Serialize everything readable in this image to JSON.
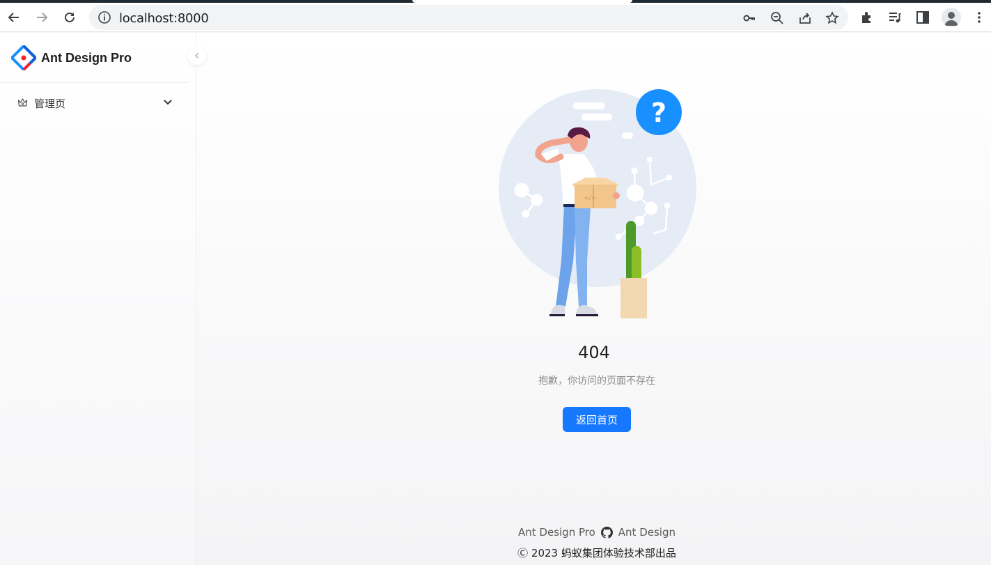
{
  "browser": {
    "url": "localhost:8000",
    "back_icon": "arrow-left-icon",
    "forward_icon": "arrow-right-icon",
    "reload_icon": "reload-icon"
  },
  "sidebar": {
    "logo_text": "Ant Design Pro",
    "menu": [
      {
        "label": "管理页",
        "icon": "crown-icon"
      }
    ]
  },
  "main": {
    "code": "404",
    "subtitle": "抱歉，你访问的页面不存在",
    "home_button": "返回首页"
  },
  "footer": {
    "link_pro": "Ant Design Pro",
    "link_antd": "Ant Design",
    "copyright": "Ⓒ 2023 蚂蚁集团体验技术部出品"
  },
  "colors": {
    "primary": "#1677ff",
    "question_badge": "#1890ff"
  }
}
